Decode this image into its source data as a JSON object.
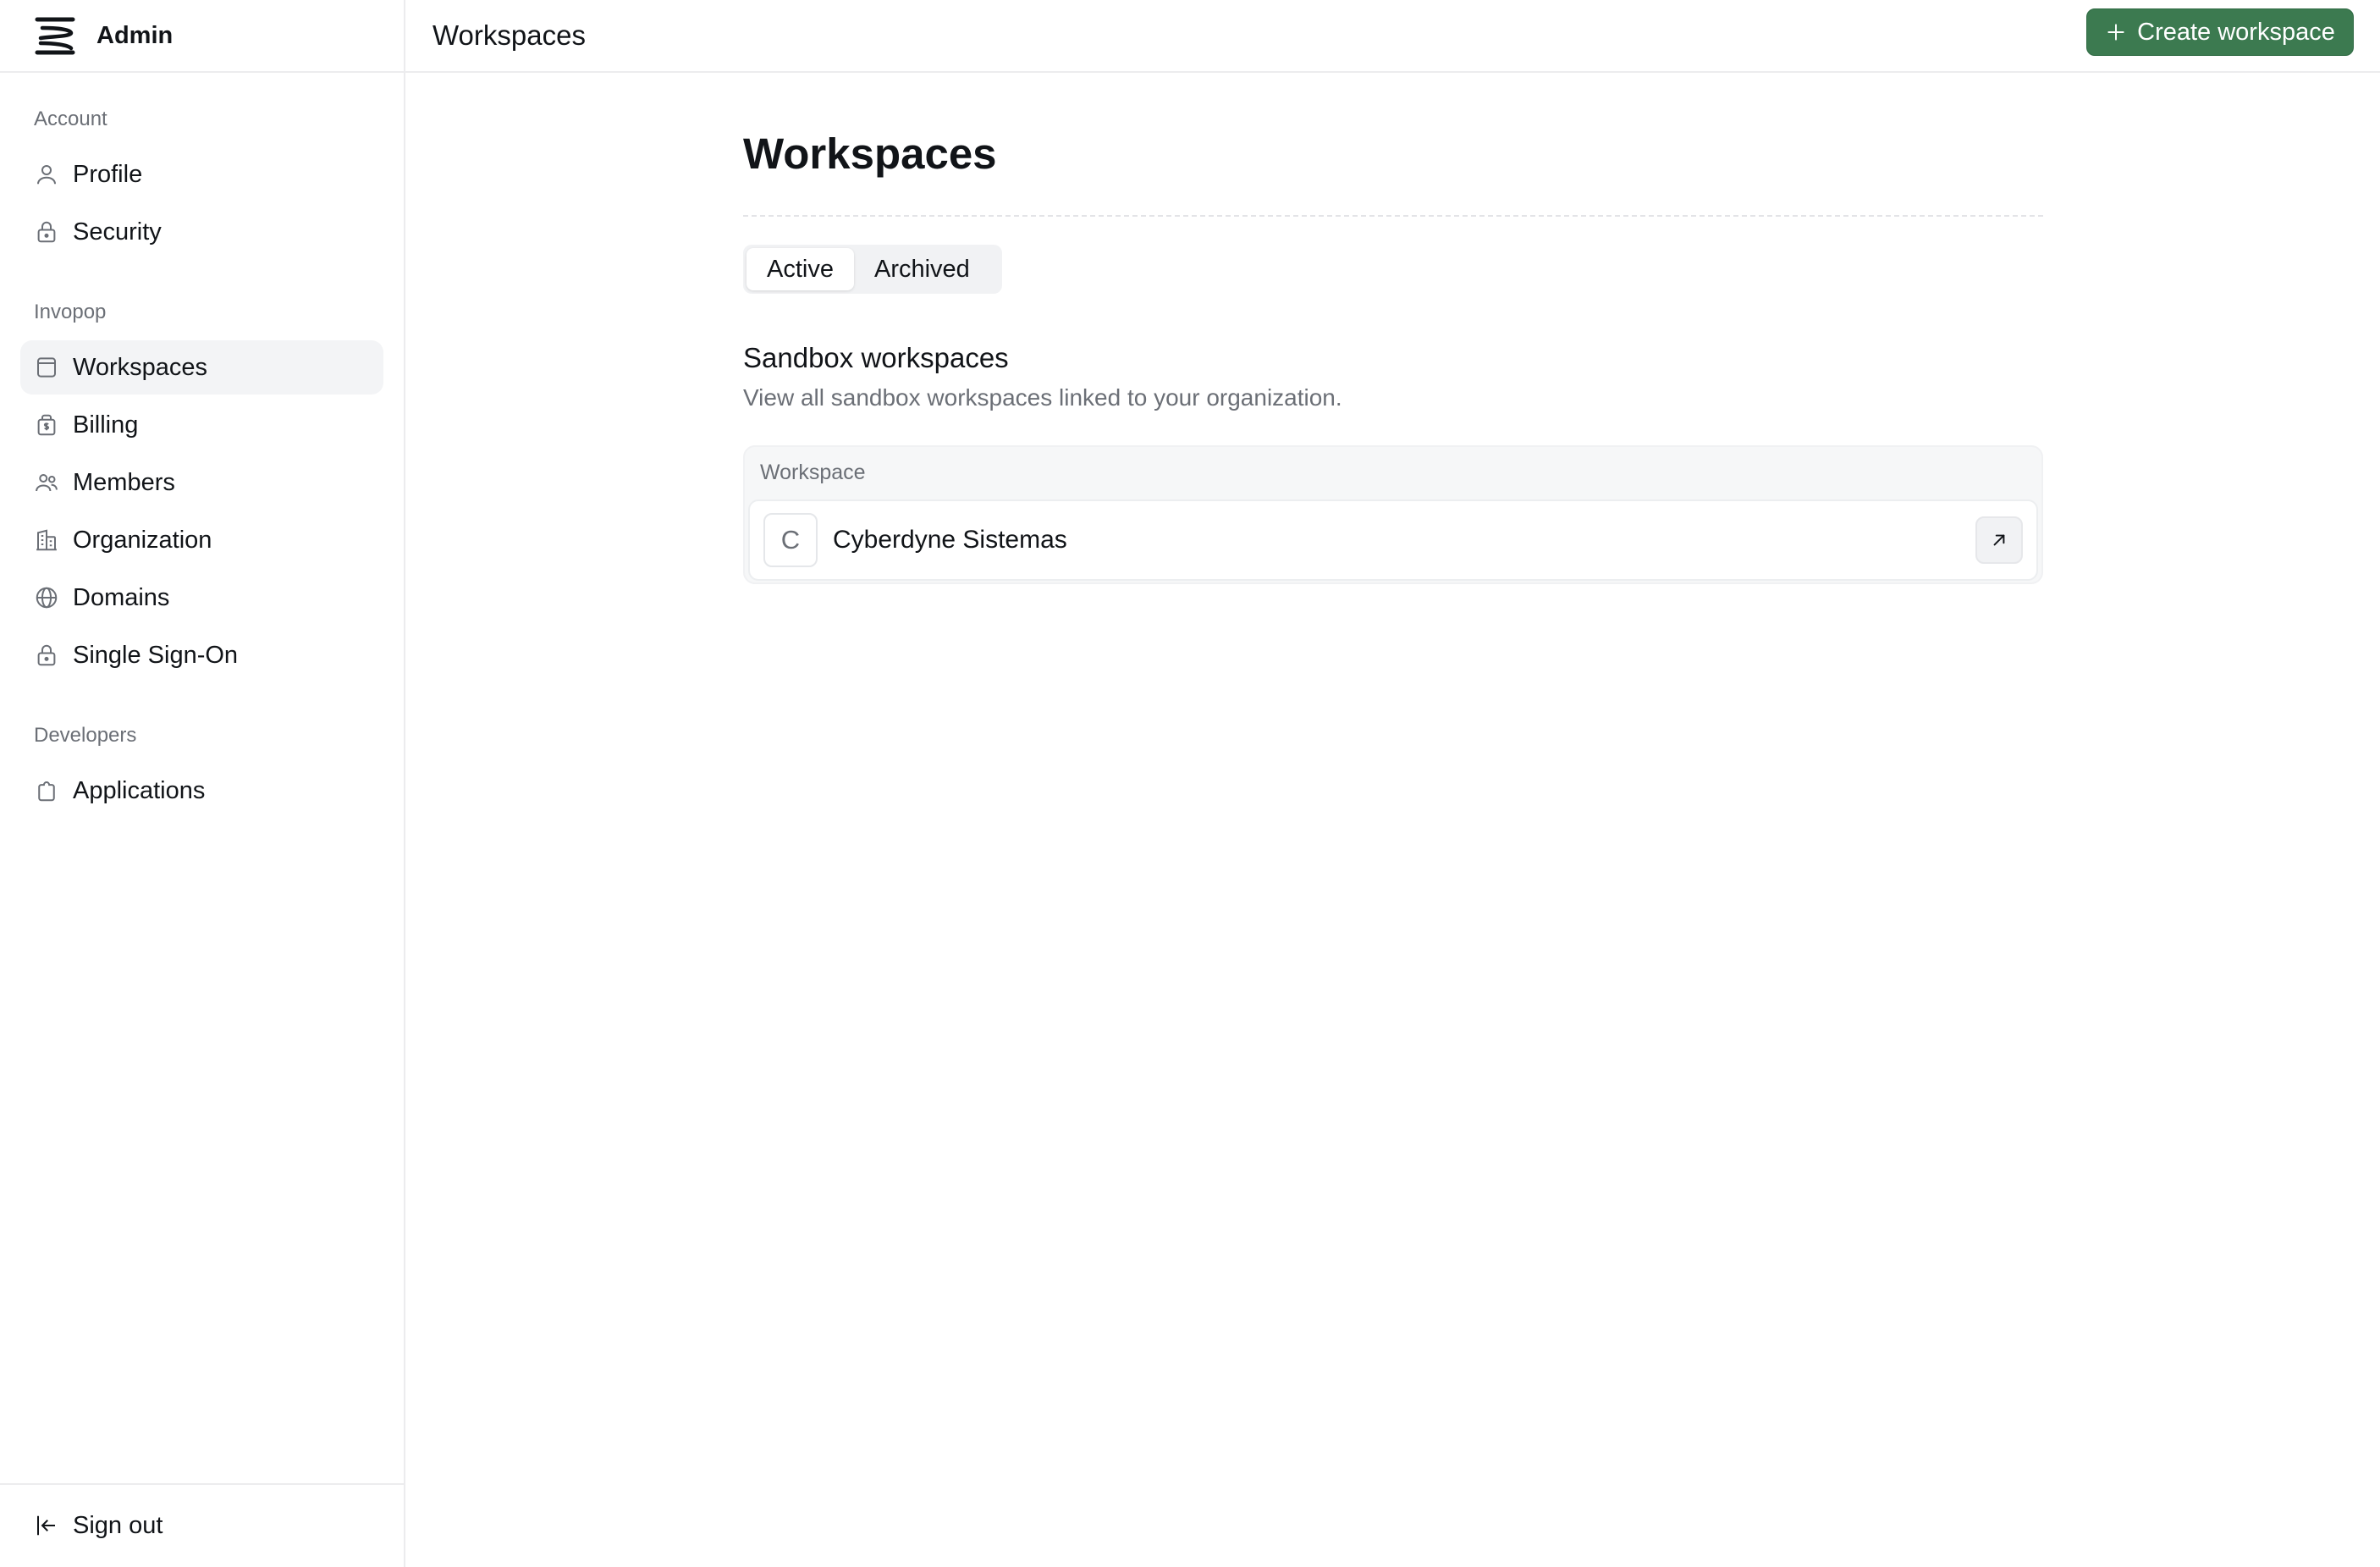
{
  "brand": {
    "name": "Admin",
    "logo_icon": "stacked-lines-logo-icon"
  },
  "sidebar": {
    "sections": [
      {
        "title": "Account",
        "items": [
          {
            "label": "Profile",
            "icon": "user-icon"
          },
          {
            "label": "Security",
            "icon": "lock-icon"
          }
        ]
      },
      {
        "title": "Invopop",
        "items": [
          {
            "label": "Workspaces",
            "icon": "workspace-icon",
            "active": true
          },
          {
            "label": "Billing",
            "icon": "billing-icon"
          },
          {
            "label": "Members",
            "icon": "members-icon"
          },
          {
            "label": "Organization",
            "icon": "building-icon"
          },
          {
            "label": "Domains",
            "icon": "globe-icon"
          },
          {
            "label": "Single Sign-On",
            "icon": "lock-icon"
          }
        ]
      },
      {
        "title": "Developers",
        "items": [
          {
            "label": "Applications",
            "icon": "app-icon"
          }
        ]
      }
    ],
    "sign_out_label": "Sign out"
  },
  "header": {
    "title": "Workspaces",
    "create_button_label": "Create workspace"
  },
  "main": {
    "title": "Workspaces",
    "tabs": [
      {
        "label": "Active",
        "active": true
      },
      {
        "label": "Archived",
        "active": false
      }
    ],
    "section_heading": "Sandbox workspaces",
    "section_subtitle": "View all sandbox workspaces linked to your organization.",
    "table": {
      "column_header": "Workspace",
      "rows": [
        {
          "initial": "C",
          "name": "Cyberdyne Sistemas"
        }
      ]
    }
  },
  "colors": {
    "accent_green": "#3c7a50",
    "active_nav_bg": "#f3f4f6",
    "muted_text": "#6b6f76"
  }
}
